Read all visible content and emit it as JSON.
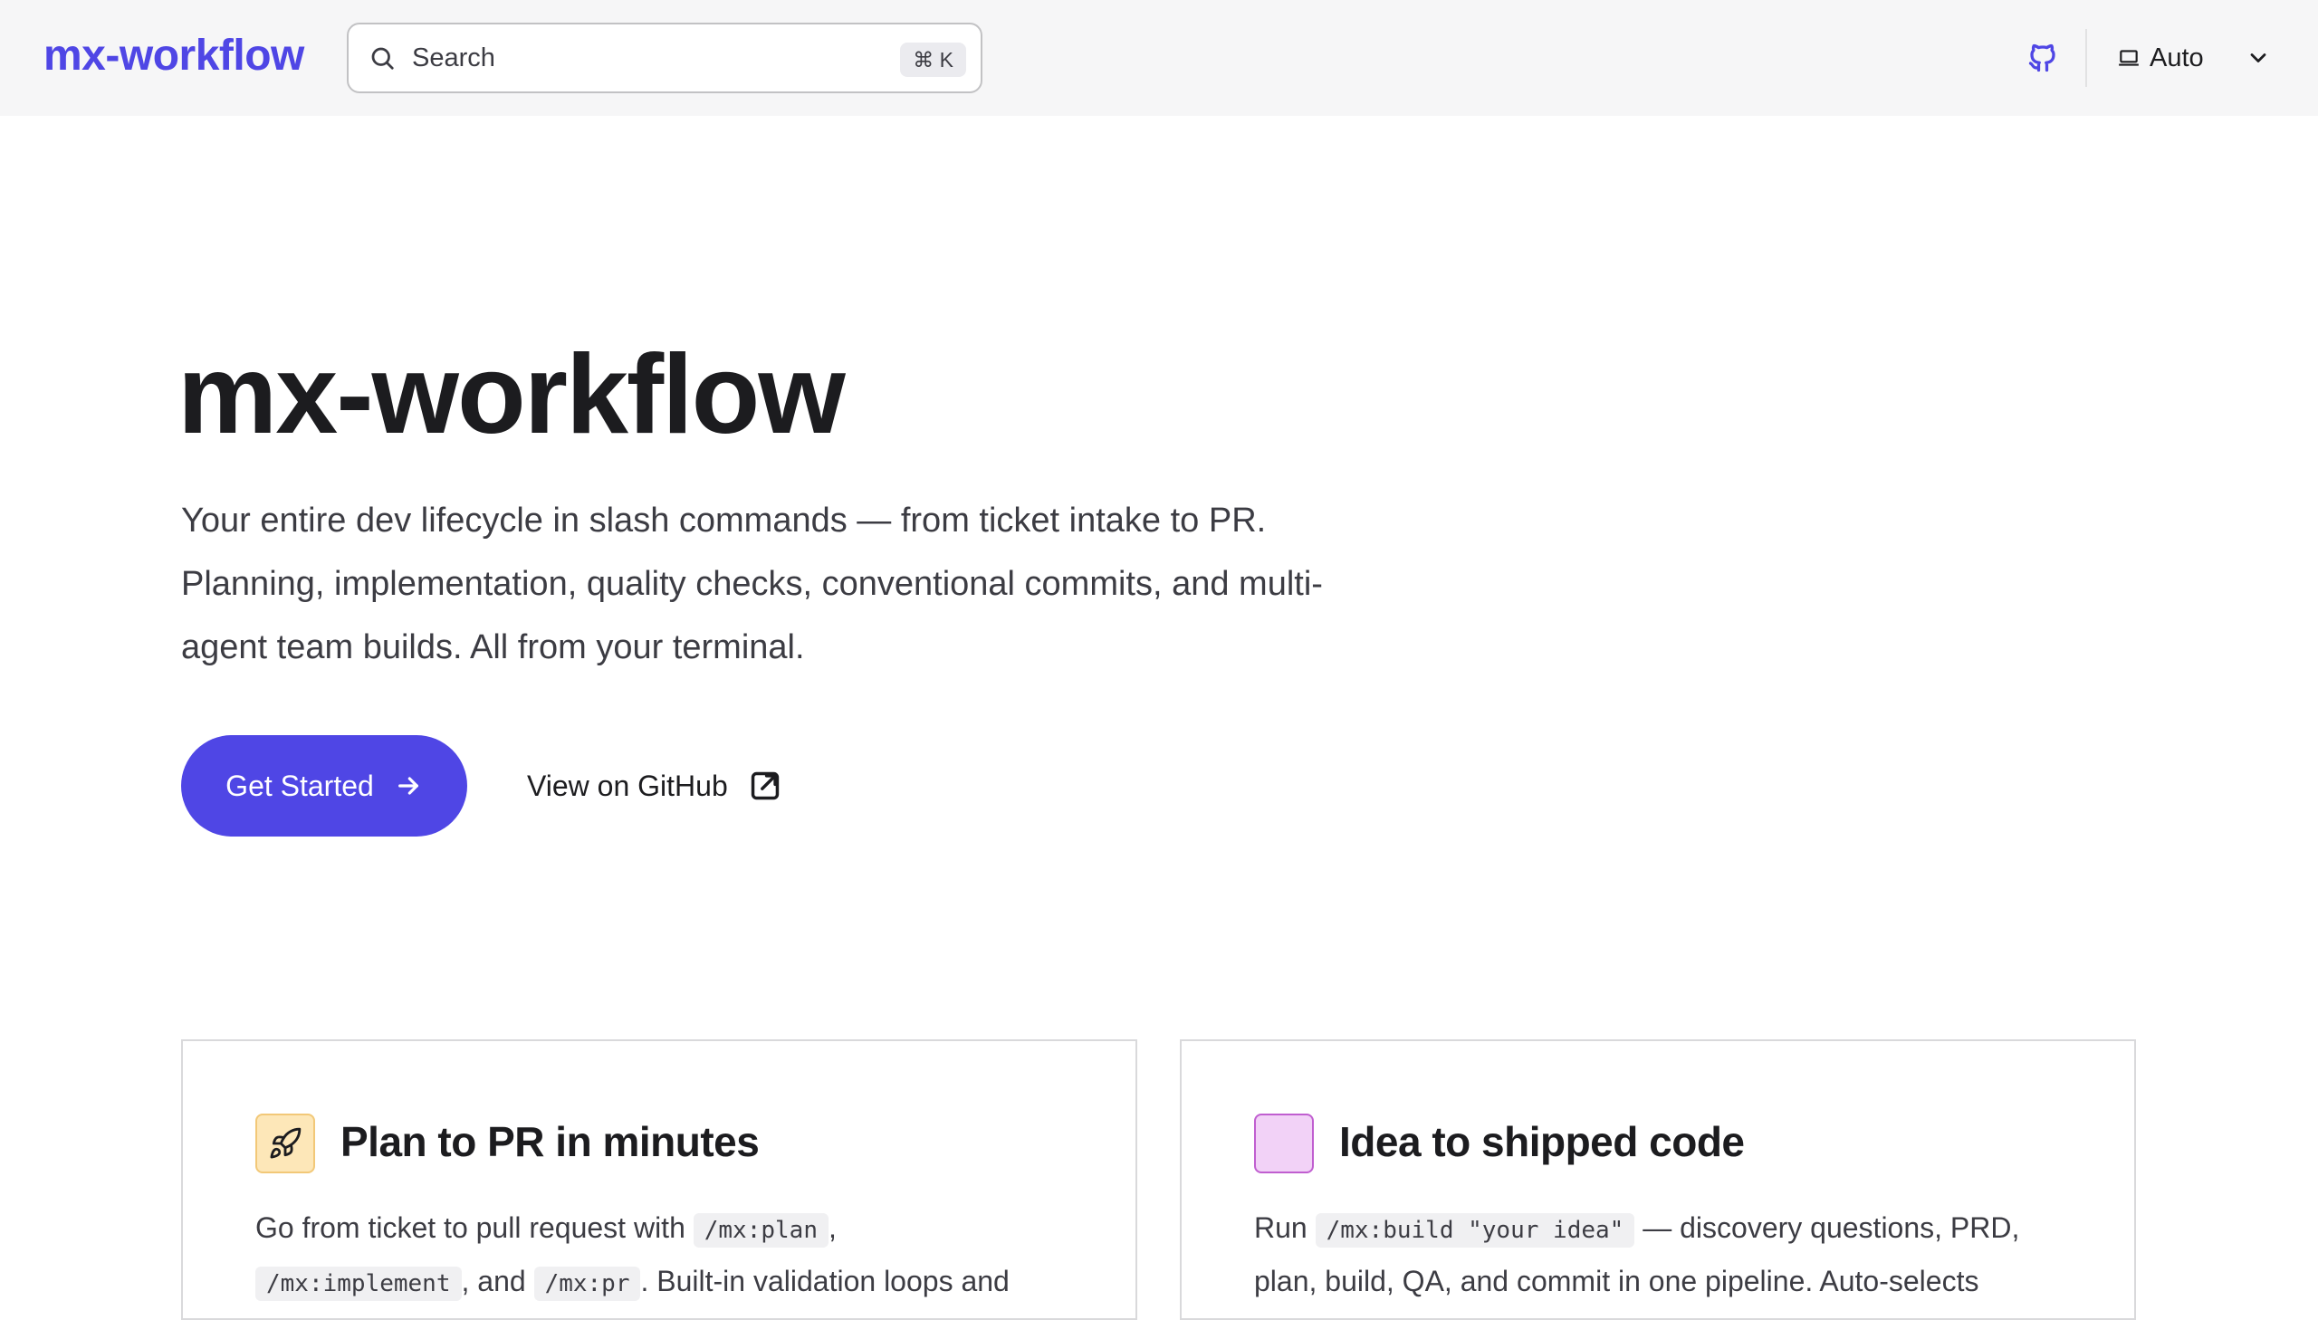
{
  "header": {
    "brand": "mx-workflow",
    "search_placeholder": "Search",
    "search_shortcut": "⌘ K",
    "appearance_label": "Auto"
  },
  "hero": {
    "title": "mx-workflow",
    "tagline": "Your entire dev lifecycle in slash commands — from ticket intake to PR. Planning, implementation, quality checks, conventional commits, and multi-agent team builds. All from your terminal.",
    "primary_button": "Get Started",
    "secondary_button": "View on GitHub"
  },
  "features": [
    {
      "title": "Plan to PR in minutes",
      "body": {
        "t1": "Go from ticket to pull request with ",
        "c1": "/mx:plan",
        "t2": ",",
        "c2": "/mx:implement",
        "t3": ", and ",
        "c3": "/mx:pr",
        "t4": ". Built-in validation loops and"
      }
    },
    {
      "title": "Idea to shipped code",
      "body": {
        "t1": "Run ",
        "c1": "/mx:build \"your idea\"",
        "t2": " — discovery questions, PRD, plan, build, QA, and commit in one pipeline. Auto-selects"
      }
    }
  ],
  "colors": {
    "brand": "#4f46e5",
    "header_bg": "#f6f6f7"
  },
  "icons": {
    "search": "search-icon",
    "github": "github-icon",
    "appearance": "laptop-icon",
    "chevron": "chevron-down-icon",
    "arrow": "arrow-right-icon",
    "external": "external-link-icon",
    "rocket": "rocket-icon"
  }
}
